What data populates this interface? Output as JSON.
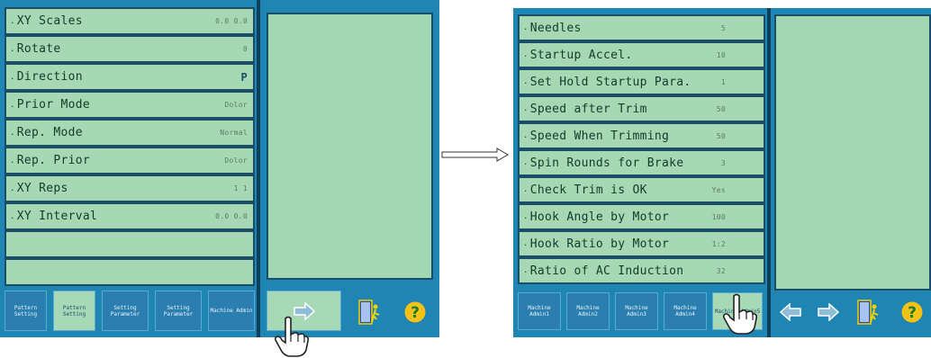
{
  "left": {
    "items": [
      {
        "label": "XY Scales",
        "value": "0.0 0.0"
      },
      {
        "label": "Rotate",
        "value": "0"
      },
      {
        "label": "Direction",
        "value": "P"
      },
      {
        "label": "Prior Mode",
        "value": "Dolor"
      },
      {
        "label": "Rep. Mode",
        "value": "Normal"
      },
      {
        "label": "Rep. Prior",
        "value": "Dolor"
      },
      {
        "label": "XY Reps",
        "value": "1 1"
      },
      {
        "label": "XY Interval",
        "value": "0.0 0.0"
      },
      {
        "label": "",
        "value": ""
      },
      {
        "label": "",
        "value": ""
      }
    ],
    "toolbar": [
      "Pattern Setting",
      "Pattern Setting",
      "Setting Parameter",
      "Setting Parameter",
      "Machine Admin"
    ]
  },
  "right": {
    "items": [
      {
        "label": "Needles",
        "value": "5"
      },
      {
        "label": "Startup Accel.",
        "value": "10"
      },
      {
        "label": "Set Hold Startup Para.",
        "value": "1"
      },
      {
        "label": "Speed after Trim",
        "value": "50"
      },
      {
        "label": "Speed When Trimming",
        "value": "50"
      },
      {
        "label": "Spin Rounds for Brake",
        "value": "3"
      },
      {
        "label": "Check Trim is OK",
        "value": "Yes"
      },
      {
        "label": "Hook Angle by Motor",
        "value": "100"
      },
      {
        "label": "Hook Ratio by Motor",
        "value": "1:2"
      },
      {
        "label": "Ratio of AC Induction",
        "value": "32"
      }
    ],
    "toolbar": [
      "Machine Admin1",
      "Machine Admin2",
      "Machine Admin3",
      "Machine Admin4",
      "Machine Admin5"
    ]
  },
  "icons": {
    "next": "arrow-right-icon",
    "prev": "arrow-left-icon",
    "exit": "exit-door-icon",
    "help": "help-icon",
    "cursor": "hand-pointer-icon",
    "transition": "long-arrow-right-icon"
  },
  "colors": {
    "panel": "#1f86b4",
    "item": "#a7d8b4",
    "border": "#1a4d68",
    "help": "#f2c316"
  }
}
